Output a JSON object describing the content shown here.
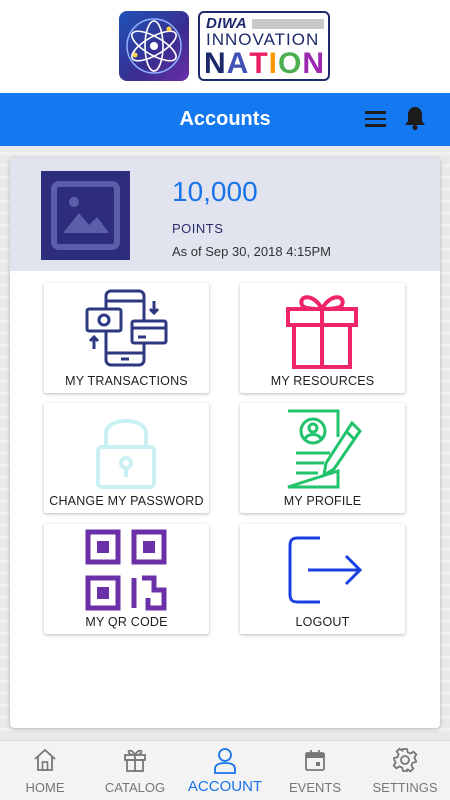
{
  "brand": {
    "diwa": "DIWA",
    "innovation": "INNOVATION",
    "nation_letters": [
      {
        "ch": "N",
        "color": "#1c2a6b"
      },
      {
        "ch": "A",
        "color": "#3f51b5"
      },
      {
        "ch": "T",
        "color": "#e91e63"
      },
      {
        "ch": "I",
        "color": "#ff9800"
      },
      {
        "ch": "O",
        "color": "#4caf50"
      },
      {
        "ch": "N",
        "color": "#9c27b0"
      }
    ]
  },
  "header": {
    "title": "Accounts",
    "menu_icon": "hamburger-menu-icon",
    "notification_icon": "bell-icon",
    "bar_color": "#1478f0"
  },
  "points": {
    "value": "10,000",
    "label": "POINTS",
    "as_of": "As of Sep 30, 2018 4:15PM"
  },
  "tiles": [
    {
      "label": "MY TRANSACTIONS",
      "icon": "transactions-icon",
      "color": "#2e3880"
    },
    {
      "label": "MY RESOURCES",
      "icon": "gift-icon",
      "color": "#f0246b"
    },
    {
      "label": "CHANGE MY PASSWORD",
      "icon": "padlock-icon",
      "color": "#c9f0f2"
    },
    {
      "label": "MY PROFILE",
      "icon": "profile-document-icon",
      "color": "#21c36b"
    },
    {
      "label": "MY QR CODE",
      "icon": "qr-code-icon",
      "color": "#6b2fa8"
    },
    {
      "label": "LOGOUT",
      "icon": "logout-icon",
      "color": "#1a3fe0"
    }
  ],
  "bottom_nav": [
    {
      "label": "HOME",
      "icon": "home-icon",
      "active": false
    },
    {
      "label": "CATALOG",
      "icon": "gift-box-icon",
      "active": false
    },
    {
      "label": "ACCOUNT",
      "icon": "person-icon",
      "active": true
    },
    {
      "label": "EVENTS",
      "icon": "calendar-icon",
      "active": false
    },
    {
      "label": "SETTINGS",
      "icon": "gear-icon",
      "active": false
    }
  ]
}
